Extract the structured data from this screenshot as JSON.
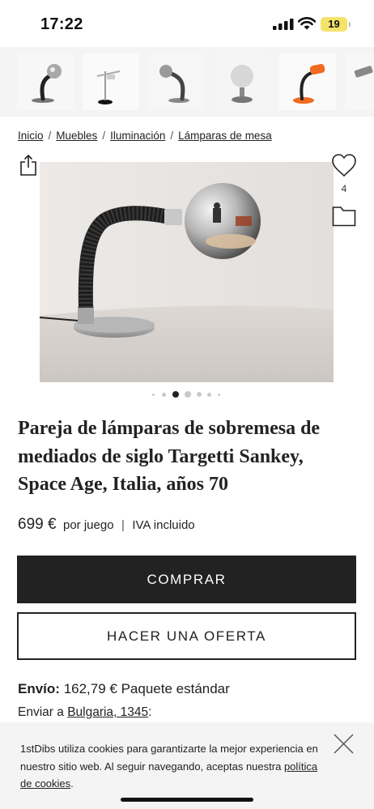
{
  "status_bar": {
    "time": "17:22",
    "battery": "19"
  },
  "thumbnails": [
    {
      "name": "thumb-black-gooseneck-chrome-ball"
    },
    {
      "name": "thumb-chrome-arm-lamp"
    },
    {
      "name": "thumb-grey-gooseneck-lamp"
    },
    {
      "name": "thumb-globe-lamp"
    },
    {
      "name": "thumb-orange-lamp"
    },
    {
      "name": "thumb-chrome-lamp"
    }
  ],
  "breadcrumb": {
    "items": [
      "Inicio",
      "Muebles",
      "Iluminación",
      "Lámparas de mesa"
    ],
    "separator": "/"
  },
  "favorites": {
    "count": "4"
  },
  "carousel": {
    "total": 7,
    "active_index": 2
  },
  "product": {
    "title": "Pareja de lámparas de sobremesa de mediados de siglo Targetti Sankey, Space Age, Italia, años 70",
    "price": "699 €",
    "price_unit": "por juego",
    "price_separator": "|",
    "price_tax": "IVA incluido"
  },
  "actions": {
    "buy_label": "COMPRAR",
    "offer_label": "HACER UNA OFERTA"
  },
  "shipping": {
    "label": "Envío:",
    "value": "162,79 € Paquete estándar",
    "send_to_prefix": "Enviar a",
    "destination": "Bulgaria, 1345",
    "send_to_suffix": ":"
  },
  "cookie": {
    "text": "1stDibs utiliza cookies para garantizarte la mejor experiencia en nuestro sitio web. Al seguir navegando, aceptas nuestra",
    "link": "política de cookies",
    "end": "."
  },
  "colors": {
    "button_dark": "#222222",
    "battery": "#f4e36b",
    "banner_bg": "#f4f4f4"
  },
  "icons": [
    "share-icon",
    "heart-icon",
    "folder-icon",
    "close-icon",
    "wifi-icon",
    "signal-icon"
  ]
}
